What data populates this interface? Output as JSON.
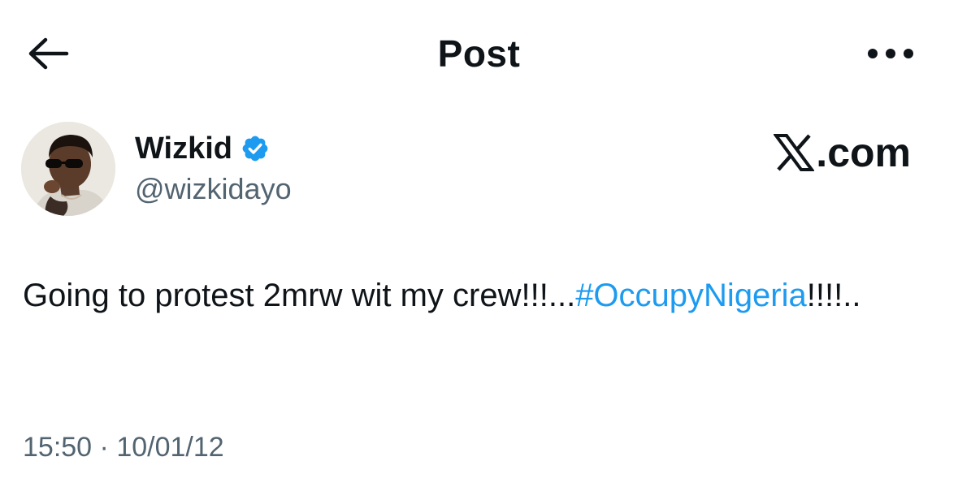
{
  "header": {
    "title": "Post",
    "back_icon": "arrow-left-icon",
    "more_icon": "more-horizontal-icon"
  },
  "author": {
    "display_name": "Wizkid",
    "handle": "@wizkidayo",
    "verified": true,
    "verified_color": "#1d9bf0"
  },
  "watermark": {
    "text": ".com",
    "logo_icon": "x-logo-icon"
  },
  "post": {
    "text_before": "Going to protest 2mrw wit my crew!!!...",
    "hashtag": "#OccupyNigeria",
    "text_after": "!!!!..",
    "hashtag_color": "#1d9bf0"
  },
  "meta": {
    "time": "15:50",
    "separator": "·",
    "date": "10/01/12"
  }
}
